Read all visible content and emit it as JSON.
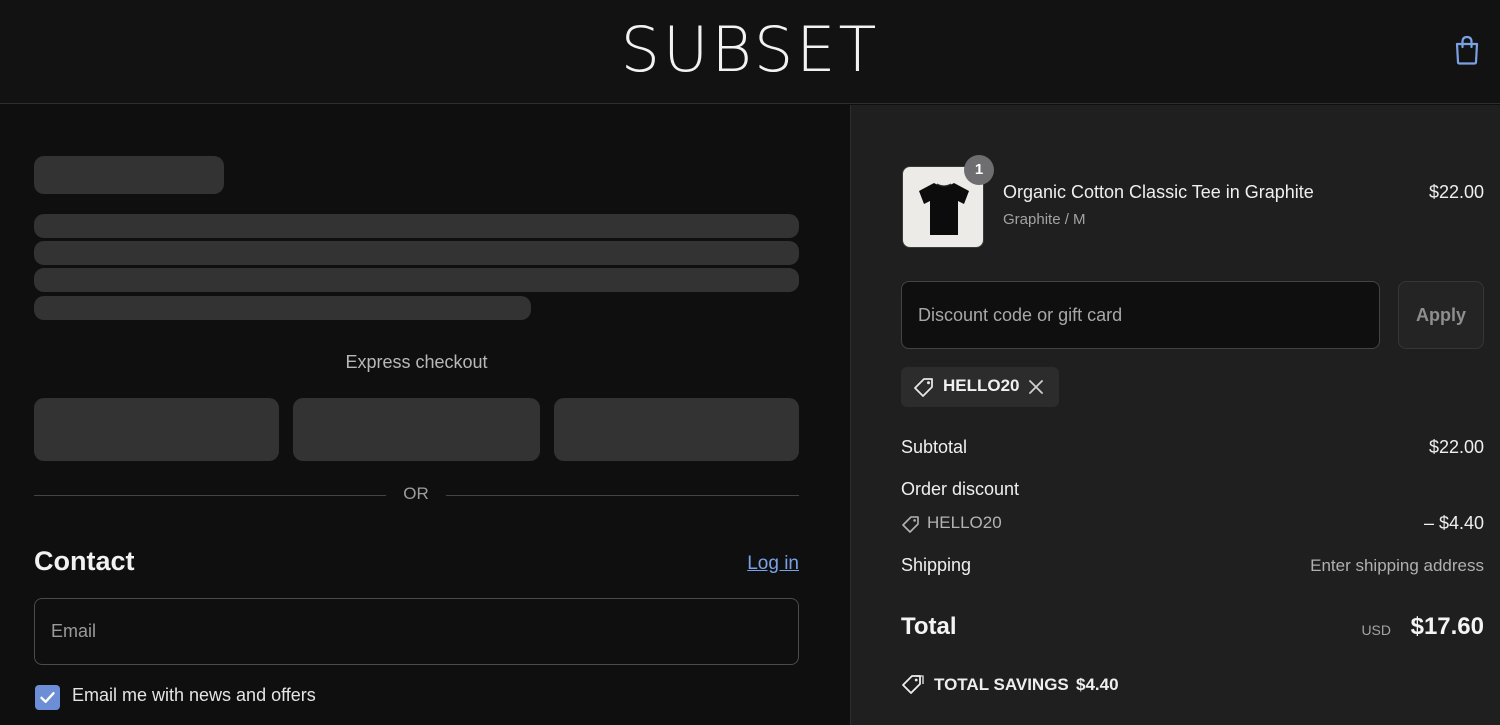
{
  "header": {
    "logo": "SUBSET",
    "cart_icon": "shopping-bag-icon"
  },
  "express_checkout": {
    "label": "Express checkout",
    "divider_text": "OR"
  },
  "contact": {
    "title": "Contact",
    "login_link": "Log in",
    "email_placeholder": "Email",
    "newsletter_label": "Email me with news and offers",
    "newsletter_checked": true
  },
  "order": {
    "item": {
      "name": "Organic Cotton Classic Tee in Graphite",
      "variant": "Graphite / M",
      "price": "$22.00",
      "quantity": "1"
    },
    "discount_placeholder": "Discount code or gift card",
    "apply_label": "Apply",
    "applied_code": "HELLO20",
    "subtotal_label": "Subtotal",
    "subtotal_value": "$22.00",
    "order_discount_label": "Order discount",
    "order_discount_code": "HELLO20",
    "order_discount_value": "– $4.40",
    "shipping_label": "Shipping",
    "shipping_value": "Enter shipping address",
    "total_label": "Total",
    "total_currency": "USD",
    "total_value": "$17.60",
    "savings_label": "TOTAL SAVINGS",
    "savings_value": "$4.40"
  },
  "colors": {
    "accent": "#6c8ed6",
    "link": "#7aa1e6",
    "background": "#0f0f10",
    "summary_background": "#1f1f20"
  }
}
